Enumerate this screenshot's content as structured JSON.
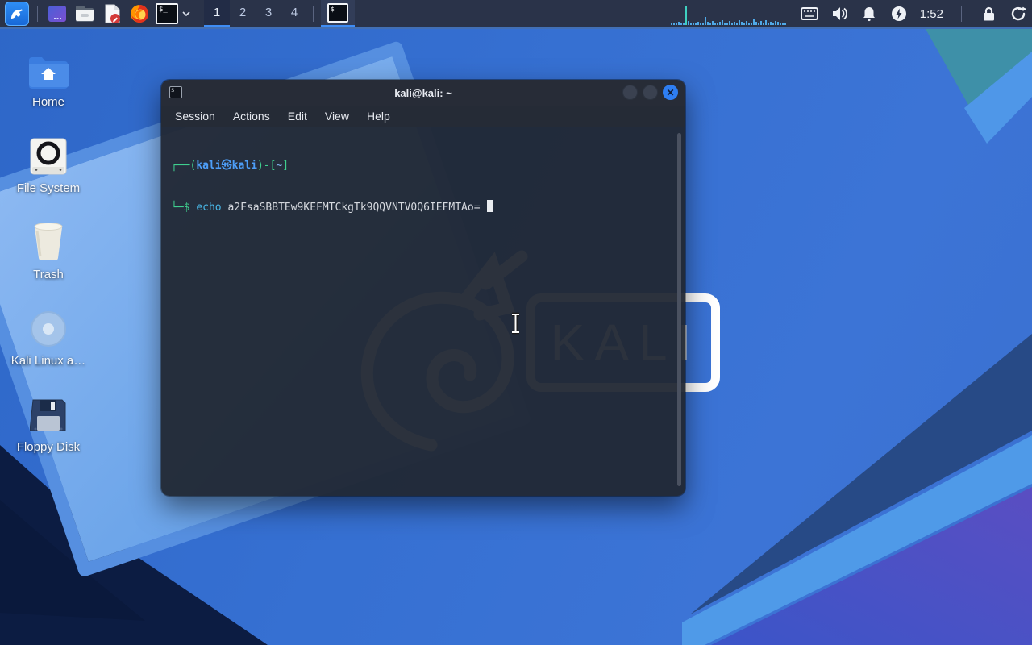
{
  "colors": {
    "panel_bg": "#2a3349",
    "accent": "#3f8df5",
    "close_button": "#2e7ef2",
    "prompt_green": "#3fcf8f",
    "prompt_blue": "#4d9ef8",
    "command_cyan": "#49b8e8",
    "terminal_fg": "#d6d9df"
  },
  "panel": {
    "launchers": [
      "kali-menu",
      "desktop-app",
      "file-manager",
      "text-editor",
      "firefox",
      "terminal-launcher"
    ],
    "workspaces": [
      "1",
      "2",
      "3",
      "4"
    ],
    "active_workspace": "1",
    "window_buttons": [
      "terminal"
    ],
    "tray": [
      "cpu-graph",
      "keyboard",
      "volume",
      "notifications",
      "power-manager",
      "clock",
      "lock-screen",
      "log-out"
    ],
    "clock": "1:52",
    "cpu_graph_bars": [
      2,
      3,
      2,
      4,
      3,
      2,
      24,
      5,
      3,
      2,
      3,
      4,
      2,
      3,
      10,
      4,
      3,
      5,
      3,
      2,
      4,
      6,
      3,
      2,
      5,
      3,
      4,
      2,
      6,
      4,
      3,
      5,
      2,
      3,
      7,
      4,
      2,
      5,
      3,
      6,
      2,
      4,
      3,
      5,
      4,
      2,
      3,
      2
    ]
  },
  "desktop": {
    "icons": [
      {
        "label": "Home"
      },
      {
        "label": "File System"
      },
      {
        "label": "Trash"
      },
      {
        "label": "Kali Linux a…"
      },
      {
        "label": "Floppy Disk"
      }
    ]
  },
  "window": {
    "title": "kali@kali: ~",
    "menu": [
      "Session",
      "Actions",
      "Edit",
      "View",
      "Help"
    ],
    "terminal": {
      "line1": {
        "open": "┌──(",
        "user": "kali㉿kali",
        "mid": ")-[",
        "path": "~",
        "close": "]"
      },
      "line2": {
        "prompt": "└─$",
        "command": "echo",
        "argument": "a2FsaSBBTEw9KEFMTCkgTk9QQVNTV0Q6IEFMTAo="
      }
    }
  },
  "wallpaper": {
    "watermark": "KALI"
  }
}
